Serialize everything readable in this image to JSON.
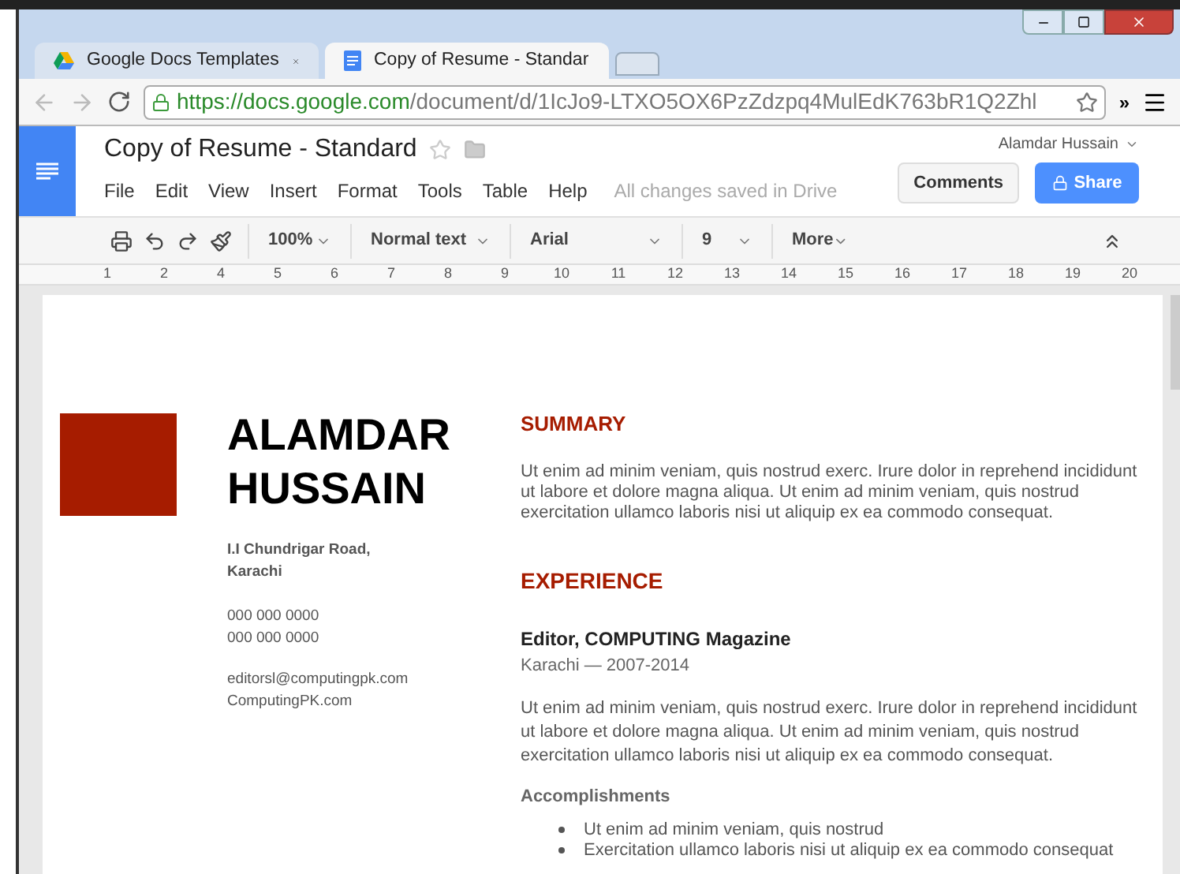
{
  "browser": {
    "tabs": [
      {
        "label": "Google Docs Templates",
        "selected": false
      },
      {
        "label": "Copy of Resume - Standar",
        "selected": true
      }
    ],
    "url_host": "https://docs.google.com",
    "url_path": "/document/d/1IcJo9-LTXO5OX6PzZdzpq4MulEdK763bR1Q2Zhl",
    "overflow": "»"
  },
  "docs": {
    "title": "Copy of Resume - Standard",
    "user": "Alamdar Hussain",
    "menu": [
      "File",
      "Edit",
      "View",
      "Insert",
      "Format",
      "Tools",
      "Table",
      "Help"
    ],
    "save_status": "All changes saved in Drive",
    "comments_button": "Comments",
    "share_button": "Share"
  },
  "toolbar": {
    "zoom": "100%",
    "style": "Normal text",
    "font": "Arial",
    "size": "9",
    "more": "More"
  },
  "ruler_numbers": [
    "1",
    "2",
    "4",
    "5",
    "6",
    "7",
    "8",
    "9",
    "10",
    "11",
    "12",
    "13",
    "14",
    "15",
    "16",
    "17",
    "18",
    "19",
    "20"
  ],
  "resume": {
    "first_name": "ALAMDAR",
    "last_name": "HUSSAIN",
    "address": [
      "I.I Chundrigar Road,",
      "Karachi"
    ],
    "phones": [
      "000 000 0000",
      "000 000 0000"
    ],
    "contacts": [
      "editorsl@computingpk.com",
      "ComputingPK.com"
    ],
    "summary_heading": "SUMMARY",
    "summary": "Ut enim ad minim veniam, quis nostrud exerc. Irure dolor in reprehend incididunt ut labore et dolore magna aliqua. Ut enim ad minim veniam, quis nostrud exercitation ullamco laboris nisi ut aliquip ex ea commodo consequat.",
    "experience_heading": "EXPERIENCE",
    "job_title": "Editor, COMPUTING Magazine",
    "job_meta": "Karachi — 2007-2014",
    "job_text": "Ut enim ad minim veniam, quis nostrud exerc. Irure dolor in reprehend incididunt ut labore et dolore magna aliqua. Ut enim ad minim veniam, quis nostrud exercitation ullamco laboris nisi ut aliquip ex ea commodo consequat.",
    "accomplishments_heading": "Accomplishments",
    "bullets": [
      "Ut enim ad minim veniam, quis nostrud",
      "Exercitation ullamco laboris nisi ut aliquip ex ea commodo consequat"
    ]
  }
}
